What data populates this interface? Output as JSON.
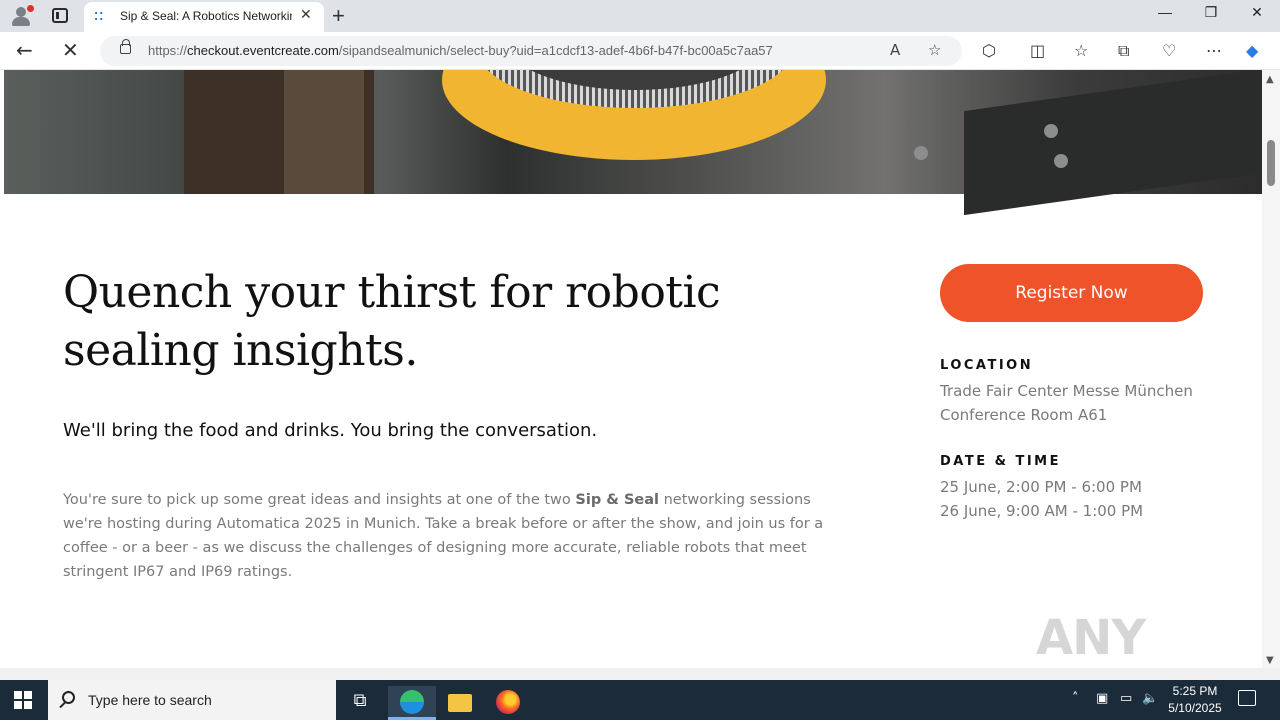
{
  "browser": {
    "tab_title": "Sip & Seal: A Robotics Networkin",
    "url_prefix": "https://",
    "url_domain": "checkout.eventcreate.com",
    "url_path": "/sipandsealmunich/select-buy?uid=a1cdcf13-adef-4b6f-b47f-bc00a5c7aa57",
    "window_controls": [
      "—",
      "❐",
      "✕"
    ]
  },
  "page": {
    "headline_line1": "Quench your thirst for robotic",
    "headline_line2": "sealing insights.",
    "subhead": "We'll bring the food and drinks. You bring the conversation.",
    "body_before": "You're sure to pick up some great ideas and insights at one of the two ",
    "body_bold": "Sip & Seal",
    "body_after": " networking sessions we're hosting during Automatica 2025 in Munich. Take a break before or after the show, and join us for a coffee - or a beer - as we discuss the challenges of designing more accurate, reliable robots that meet stringent IP67 and IP69 ratings.",
    "register_label": "Register Now",
    "location_label": "LOCATION",
    "location_line1": "Trade Fair Center Messe München",
    "location_line2": "Conference Room A61",
    "datetime_label": "DATE & TIME",
    "date1": "25 June, 2:00 PM - 6:00 PM",
    "date2": "26 June, 9:00 AM - 1:00 PM",
    "watermark": "ANY RUN"
  },
  "taskbar": {
    "search_placeholder": "Type here to search",
    "time": "5:25 PM",
    "date": "5/10/2025"
  },
  "colors": {
    "accent": "#ef5329",
    "heading": "#111111",
    "muted": "#7a7a7a"
  }
}
